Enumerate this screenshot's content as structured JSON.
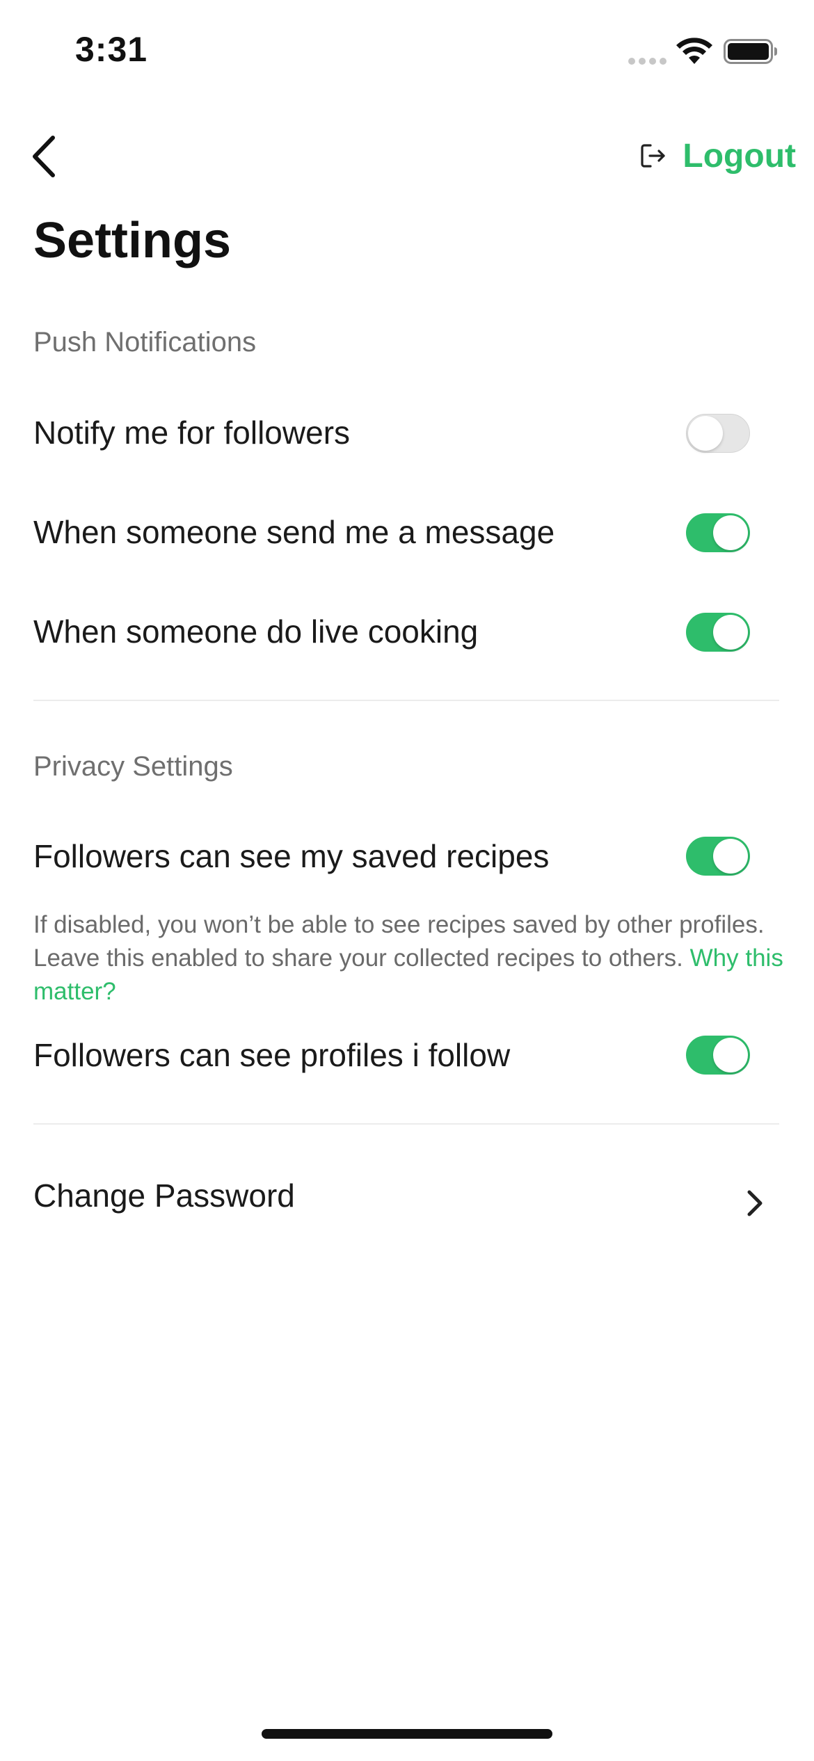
{
  "status_bar": {
    "time": "3:31"
  },
  "header": {
    "back_icon": "chevron-left-icon",
    "logout_icon": "logout-icon",
    "logout_label": "Logout",
    "title": "Settings"
  },
  "push_notifications": {
    "label": "Push Notifications",
    "items": [
      {
        "label": "Notify me for followers",
        "enabled": false
      },
      {
        "label": "When someone send me a message",
        "enabled": true
      },
      {
        "label": "When someone do live cooking",
        "enabled": true
      }
    ]
  },
  "privacy_settings": {
    "label": "Privacy Settings",
    "items": [
      {
        "label": "Followers can see my saved recipes",
        "enabled": true
      },
      {
        "label": "Followers can see profiles i follow",
        "enabled": true
      }
    ],
    "help_text": "If disabled, you won’t be able to see recipes saved by other profiles. Leave this enabled to share your collected recipes to others.",
    "help_link": "Why this matter?"
  },
  "account": {
    "change_password_label": "Change Password",
    "chevron_icon": "chevron-right-icon"
  },
  "colors": {
    "accent": "#2EBD6B",
    "toggle_off": "#E6E6E6",
    "secondary_text": "#6F6F6F"
  }
}
